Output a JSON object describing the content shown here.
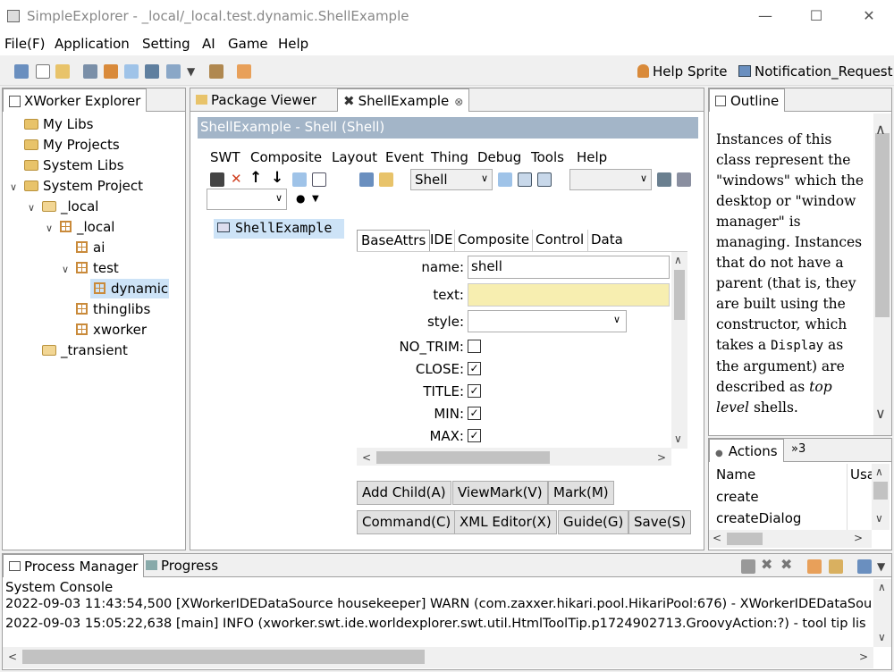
{
  "window": {
    "title": "SimpleExplorer - _local/_local.test.dynamic.ShellExample"
  },
  "menu": [
    "File(F)",
    "Application",
    "Setting",
    "AI",
    "Game",
    "Help"
  ],
  "toolbar_right": {
    "help_sprite": "Help Sprite",
    "notification": "Notification_Request"
  },
  "explorer": {
    "tab": "XWorker Explorer",
    "tree": [
      {
        "label": "My Libs",
        "type": "folder"
      },
      {
        "label": "My Projects",
        "type": "folder"
      },
      {
        "label": "System Libs",
        "type": "folder"
      },
      {
        "label": "System Project",
        "type": "folder",
        "expanded": true
      },
      {
        "label": "_local",
        "type": "folder",
        "expanded": true
      },
      {
        "label": "_local",
        "type": "package",
        "expanded": true
      },
      {
        "label": "ai",
        "type": "package"
      },
      {
        "label": "test",
        "type": "package",
        "expanded": true
      },
      {
        "label": "dynamic",
        "type": "package",
        "selected": true
      },
      {
        "label": "thinglibs",
        "type": "package"
      },
      {
        "label": "xworker",
        "type": "package"
      },
      {
        "label": "_transient",
        "type": "folder"
      }
    ]
  },
  "editor": {
    "tabs": [
      "Package Viewer",
      "ShellExample"
    ],
    "header": "ShellExample - Shell  (Shell)",
    "menu": [
      "SWT",
      "Composite",
      "Layout",
      "Event",
      "Thing",
      "Debug",
      "Tools",
      "Help"
    ],
    "type_select": "Shell",
    "outline_node": "ShellExample",
    "prop_tabs": [
      "BaseAttrs",
      "IDE",
      "Composite",
      "Control",
      "Data"
    ],
    "fields": [
      {
        "label": "name:",
        "value": "shell",
        "kind": "text"
      },
      {
        "label": "text:",
        "value": "",
        "kind": "text-highlight"
      },
      {
        "label": "style:",
        "value": "",
        "kind": "select"
      },
      {
        "label": "NO_TRIM:",
        "checked": false,
        "kind": "check"
      },
      {
        "label": "CLOSE:",
        "checked": true,
        "kind": "check"
      },
      {
        "label": "TITLE:",
        "checked": true,
        "kind": "check"
      },
      {
        "label": "MIN:",
        "checked": true,
        "kind": "check"
      },
      {
        "label": "MAX:",
        "checked": true,
        "kind": "check"
      }
    ],
    "buttons_row1": [
      "Add Child(A)",
      "ViewMark(V)",
      "Mark(M)"
    ],
    "buttons_row2": [
      "Command(C)",
      "XML Editor(X)",
      "Guide(G)",
      "Save(S)"
    ]
  },
  "outline": {
    "tab": "Outline",
    "text_parts": [
      "Instances of this class represent the \"windows\" which the desktop or \"window manager\" is managing. Instances that do not have a parent (that is, they are built using the constructor, which takes a ",
      "Display",
      " as the argument) are described as ",
      "top level",
      " shells."
    ]
  },
  "actions": {
    "tab": "Actions",
    "overflow": "»3",
    "columns": [
      "Name",
      "Usa"
    ],
    "rows": [
      "create",
      "createDialog"
    ]
  },
  "bottom": {
    "tabs": [
      "Process Manager",
      "Progress"
    ],
    "console_title": "System Console",
    "lines": [
      "2022-09-03 11:43:54,500 [XWorkerIDEDataSource housekeeper]  WARN (com.zaxxer.hikari.pool.HikariPool:676) - XWorkerIDEDataSou",
      "2022-09-03 15:05:22,638 [main]  INFO (xworker.swt.ide.worldexplorer.swt.util.HtmlToolTip.p1724902713.GroovyAction:?) - tool tip lis"
    ]
  },
  "colors": {
    "header_bg": "#a3b5c8",
    "selected_bg": "#cde3f7",
    "highlight_field": "#f7eeb0"
  }
}
